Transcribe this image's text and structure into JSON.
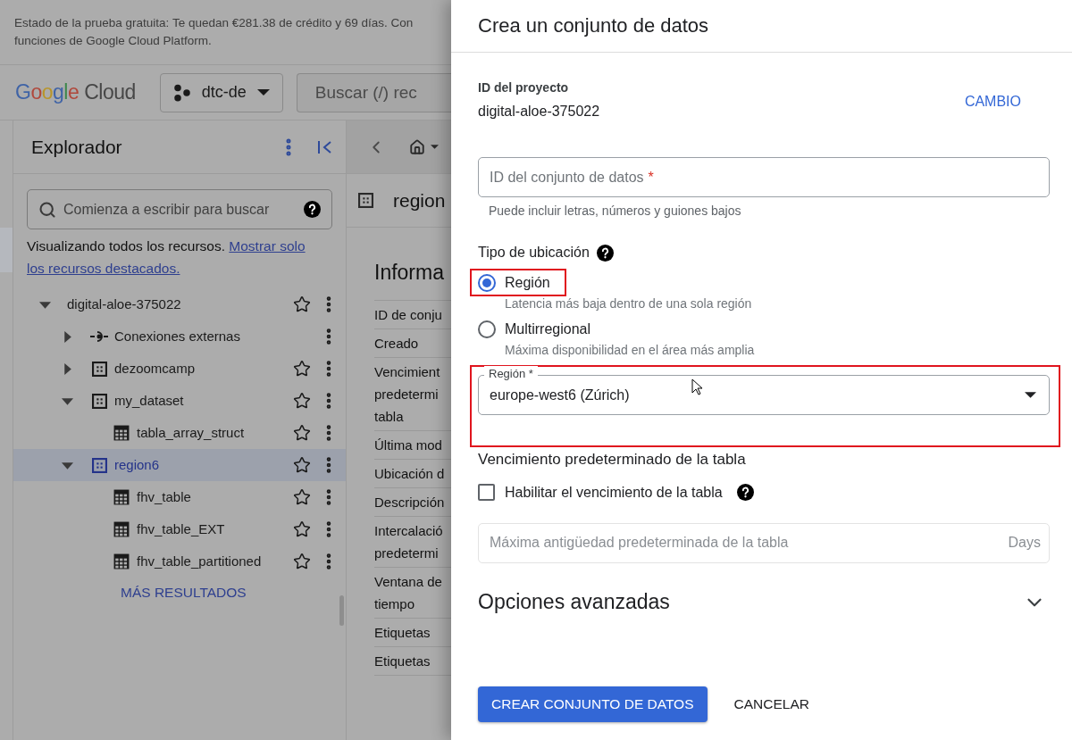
{
  "banner": {
    "lines": [
      "Estado de la prueba gratuita: Te quedan €281.38 de crédito y 69 días. Con",
      "funciones de Google Cloud Platform."
    ]
  },
  "header": {
    "logo": {
      "brand": "Google",
      "product": "Cloud"
    },
    "project": "dtc-de",
    "search": {
      "placeholder": "Buscar (/) rec"
    }
  },
  "explorer": {
    "title": "Explorador",
    "search": {
      "placeholder": "Comienza a escribir para buscar"
    },
    "notice": "Visualizando todos los recursos.",
    "notice_link": [
      "Mostrar solo",
      "los recursos destacados."
    ],
    "tree": [
      {
        "label": "digital-aloe-375022",
        "kind": "project",
        "expanded": true,
        "selected": false,
        "children": [
          {
            "label": "Conexiones externas",
            "kind": "connection",
            "expanded": false,
            "selected": false
          },
          {
            "label": "dezoomcamp",
            "kind": "dataset",
            "expanded": false,
            "selected": false
          },
          {
            "label": "my_dataset",
            "kind": "dataset",
            "expanded": true,
            "selected": false,
            "children": [
              {
                "label": "tabla_array_struct",
                "kind": "table",
                "selected": false
              }
            ]
          },
          {
            "label": "region6",
            "kind": "dataset",
            "expanded": true,
            "selected": true,
            "children": [
              {
                "label": "fhv_table",
                "kind": "table",
                "selected": false
              },
              {
                "label": "fhv_table_EXT",
                "kind": "table",
                "selected": false
              },
              {
                "label": "fhv_table_partitioned",
                "kind": "table",
                "selected": false
              }
            ]
          }
        ]
      }
    ],
    "more": "MÁS RESULTADOS"
  },
  "content": {
    "title": "region",
    "heading": "Informa",
    "rows": [
      {
        "lines": [
          "ID de conju"
        ]
      },
      {
        "lines": [
          "Creado"
        ]
      },
      {
        "lines": [
          "Vencimient",
          "predetermi",
          "tabla"
        ]
      },
      {
        "lines": [
          "Última mod"
        ]
      },
      {
        "lines": [
          "Ubicación d"
        ]
      },
      {
        "lines": [
          "Descripción"
        ]
      },
      {
        "lines": [
          "Intercalació",
          "predetermi"
        ]
      },
      {
        "lines": [
          "Ventana de",
          "tiempo"
        ]
      },
      {
        "lines": [
          "Etiquetas"
        ]
      },
      {
        "lines": [
          "Etiquetas"
        ]
      }
    ]
  },
  "dialog": {
    "title": "Crea un conjunto de datos",
    "project": {
      "label": "ID del proyecto",
      "value": "digital-aloe-375022",
      "action": "CAMBIO"
    },
    "dataset_id": {
      "label": "ID del conjunto de datos",
      "required_mark": "*",
      "hint": "Puede incluir letras, números y guiones bajos"
    },
    "location": {
      "label": "Tipo de ubicación",
      "options": [
        {
          "label": "Región",
          "description": "Latencia más baja dentro de una sola región",
          "selected": true,
          "highlighted": true
        },
        {
          "label": "Multirregional",
          "description": "Máxima disponibilidad en el área más amplia",
          "selected": false,
          "highlighted": false
        }
      ]
    },
    "region": {
      "label": "Región *",
      "value": "europe-west6 (Zúrich)",
      "highlighted": true
    },
    "expiration": {
      "title": "Vencimiento predeterminado de la tabla",
      "checkbox": {
        "label": "Habilitar el vencimiento de la tabla",
        "checked": false
      },
      "max_age": {
        "placeholder": "Máxima antigüedad predeterminada de la tabla",
        "suffix": "Days",
        "disabled": true
      }
    },
    "advanced": {
      "title": "Opciones avanzadas",
      "expanded": false
    },
    "buttons": [
      {
        "label": "CREAR CONJUNTO DE DATOS",
        "kind": "primary"
      },
      {
        "label": "CANCELAR",
        "kind": "text"
      }
    ]
  }
}
